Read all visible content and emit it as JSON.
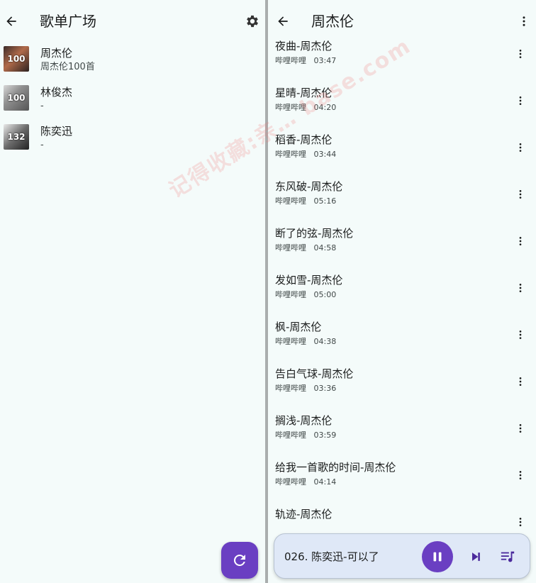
{
  "left": {
    "title": "歌单广场",
    "playlists": [
      {
        "name": "周杰伦",
        "subtitle": "周杰伦100首",
        "badge": "100"
      },
      {
        "name": "林俊杰",
        "subtitle": "-",
        "badge": "100"
      },
      {
        "name": "陈奕迅",
        "subtitle": "-",
        "badge": "132"
      }
    ]
  },
  "right": {
    "title": "周杰伦",
    "songs": [
      {
        "title": "夜曲-周杰伦",
        "source": "哔哩哔哩",
        "duration": "03:47"
      },
      {
        "title": "星晴-周杰伦",
        "source": "哔哩哔哩",
        "duration": "04:20"
      },
      {
        "title": "稻香-周杰伦",
        "source": "哔哩哔哩",
        "duration": "03:44"
      },
      {
        "title": "东风破-周杰伦",
        "source": "哔哩哔哩",
        "duration": "05:16"
      },
      {
        "title": "断了的弦-周杰伦",
        "source": "哔哩哔哩",
        "duration": "04:58"
      },
      {
        "title": "发如雪-周杰伦",
        "source": "哔哩哔哩",
        "duration": "05:00"
      },
      {
        "title": "枫-周杰伦",
        "source": "哔哩哔哩",
        "duration": "04:38"
      },
      {
        "title": "告白气球-周杰伦",
        "source": "哔哩哔哩",
        "duration": "03:36"
      },
      {
        "title": "搁浅-周杰伦",
        "source": "哔哩哔哩",
        "duration": "03:59"
      },
      {
        "title": "给我一首歌的时间-周杰伦",
        "source": "哔哩哔哩",
        "duration": "04:14"
      },
      {
        "title": "轨迹-周杰伦",
        "source": "",
        "duration": ""
      }
    ]
  },
  "player": {
    "now_playing": "026. 陈奕迅-可以了"
  },
  "watermark": "记得收藏:亲… base.com",
  "colors": {
    "background": "#f4fbfa",
    "accent": "#6a3fc2",
    "player_bg": "#dfe8f7",
    "divider": "#a9adad"
  },
  "icons": {
    "back": "arrow-left-icon",
    "settings": "gear-icon",
    "more": "more-vert-icon",
    "refresh": "refresh-icon",
    "pause": "pause-icon",
    "next": "skip-next-icon",
    "queue": "queue-music-icon"
  }
}
